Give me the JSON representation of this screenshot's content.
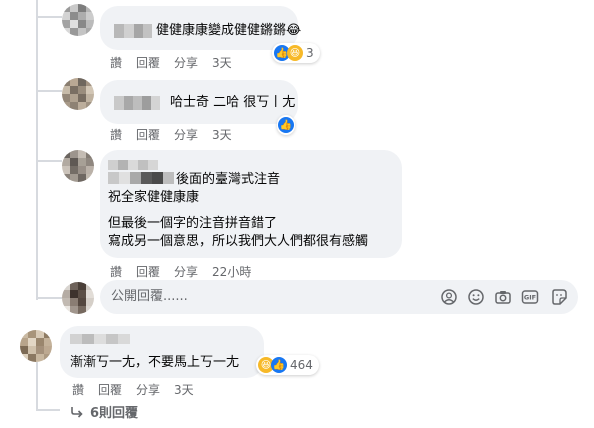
{
  "colors": {
    "bubble": "#f0f2f5",
    "meta": "#65676b",
    "like": "#1877f2",
    "haha": "#f7b928",
    "thread": "#d7dadf"
  },
  "comments": [
    {
      "text_lines": [
        "健健康康變成健健鏘鏘😂"
      ],
      "actions": [
        "讚",
        "回覆",
        "分享"
      ],
      "time": "3天",
      "reactions": {
        "icons": [
          "like-icon",
          "haha-icon"
        ],
        "count": "3"
      }
    },
    {
      "text_lines": [
        "哈士奇 二哈 很丂丨尢"
      ],
      "actions": [
        "讚",
        "回覆",
        "分享"
      ],
      "time": "3天",
      "reactions": {
        "icons": [
          "like-icon"
        ],
        "count": ""
      }
    },
    {
      "text_lines": [
        "後面的臺灣式注音",
        "祝全家健健康康",
        "但最後一個字的注音拼音錯了",
        "寫成另一個意思，所以我們大人們都很有感觸"
      ],
      "actions": [
        "讚",
        "回覆",
        "分享"
      ],
      "time": "22小時",
      "reactions": {
        "icons": [],
        "count": ""
      }
    }
  ],
  "reply_box": {
    "placeholder": "公開回覆......",
    "tools": [
      "avatar-sticker-icon",
      "emoji-icon",
      "camera-icon",
      "gif-icon",
      "sticker-icon"
    ]
  },
  "parent_comment": {
    "text_lines": [
      "漸漸丂一尢，不要馬上丂一尢"
    ],
    "actions": [
      "讚",
      "回覆",
      "分享"
    ],
    "time": "3天",
    "reactions": {
      "icons": [
        "haha-icon",
        "like-icon"
      ],
      "count": "464"
    }
  },
  "more_replies": {
    "label": "6則回覆"
  }
}
